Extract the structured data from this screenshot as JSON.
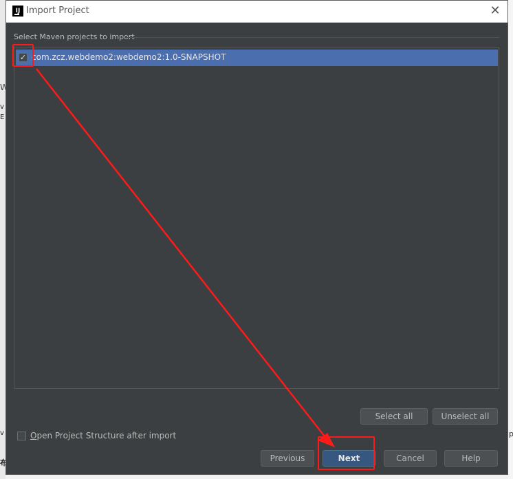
{
  "dialog": {
    "title": "Import Project",
    "section_label": "Select Maven projects to import",
    "projects": [
      {
        "label": "com.zcz.webdemo2:webdemo2:1.0-SNAPSHOT",
        "checked": true,
        "selected": true
      }
    ],
    "buttons": {
      "select_all": "Select all",
      "unselect_all": "Unselect all",
      "previous": "Previous",
      "next": "Next",
      "cancel": "Cancel",
      "help": "Help"
    },
    "open_structure": {
      "mnemonic": "O",
      "rest": "pen Project Structure after import",
      "checked": false
    }
  },
  "background_fragments": [
    "W",
    "v",
    "E",
    "v",
    "布",
    "p"
  ],
  "colors": {
    "dialog_bg": "#3c3f41",
    "selection": "#4b6eaf",
    "primary_button": "#365880",
    "annotation": "#ff1a1a"
  },
  "icons": [
    "intellij-logo-icon",
    "close-icon",
    "checkbox-checked-icon"
  ]
}
